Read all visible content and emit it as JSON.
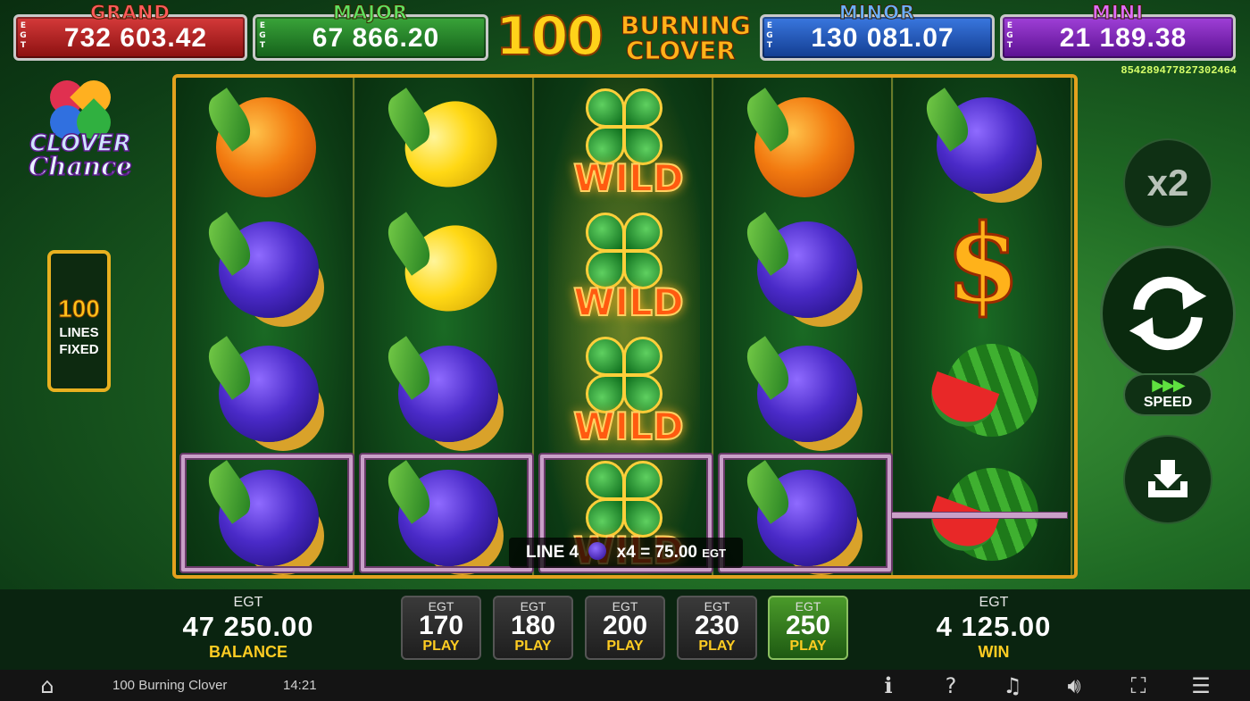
{
  "jackpots": {
    "grand": {
      "label": "GRAND",
      "egt": "EGT",
      "value": "732 603.42",
      "color": "#d63a3a"
    },
    "major": {
      "label": "MAJOR",
      "egt": "EGT",
      "value": "67 866.20",
      "color": "#2f9a2f"
    },
    "minor": {
      "label": "MINOR",
      "egt": "EGT",
      "value": "130 081.07",
      "color": "#2c64d0"
    },
    "mini": {
      "label": "MINI",
      "egt": "EGT",
      "value": "21 189.38",
      "color": "#8a30c8"
    }
  },
  "game_title": {
    "number": "100",
    "word1": "BURNING",
    "word2": "CLOVER"
  },
  "ticket_id": "854289477827302464",
  "side_logo": {
    "line1": "CLOVER",
    "line2": "Chance"
  },
  "lines_info": {
    "number": "100",
    "line1": "LINES",
    "line2": "FIXED"
  },
  "reels": [
    [
      "orange",
      "plum",
      "plum",
      "plum"
    ],
    [
      "lemon",
      "lemon",
      "plum",
      "plum"
    ],
    [
      "wild",
      "wild",
      "wild",
      "wild"
    ],
    [
      "orange",
      "plum",
      "plum",
      "plum"
    ],
    [
      "plum",
      "dollar",
      "watermelon",
      "watermelon"
    ]
  ],
  "wild_label": "WILD",
  "dollar_symbol": "$",
  "line_win": {
    "line": "LINE 4",
    "symbol_icon": "plum-icon",
    "multiplier": "x4 = 75.00",
    "currency": "EGT"
  },
  "controls": {
    "multiplier": "x2",
    "spin_icon": "refresh-icon",
    "speed_arrows": "▶▶▶",
    "speed_label": "SPEED",
    "collect_icon": "collect-tray-icon"
  },
  "balance": {
    "currency": "EGT",
    "value": "47 250.00",
    "label": "BALANCE"
  },
  "win": {
    "currency": "EGT",
    "value": "4 125.00",
    "label": "WIN"
  },
  "bets": [
    {
      "currency": "EGT",
      "value": "170",
      "label": "PLAY",
      "active": false
    },
    {
      "currency": "EGT",
      "value": "180",
      "label": "PLAY",
      "active": false
    },
    {
      "currency": "EGT",
      "value": "200",
      "label": "PLAY",
      "active": false
    },
    {
      "currency": "EGT",
      "value": "230",
      "label": "PLAY",
      "active": false
    },
    {
      "currency": "EGT",
      "value": "250",
      "label": "PLAY",
      "active": true
    }
  ],
  "status_bar": {
    "game_name": "100 Burning Clover",
    "time": "14:21",
    "icons": [
      "home-icon",
      "info-icon",
      "help-icon",
      "music-icon",
      "volume-icon",
      "fullscreen-icon",
      "menu-icon"
    ]
  }
}
